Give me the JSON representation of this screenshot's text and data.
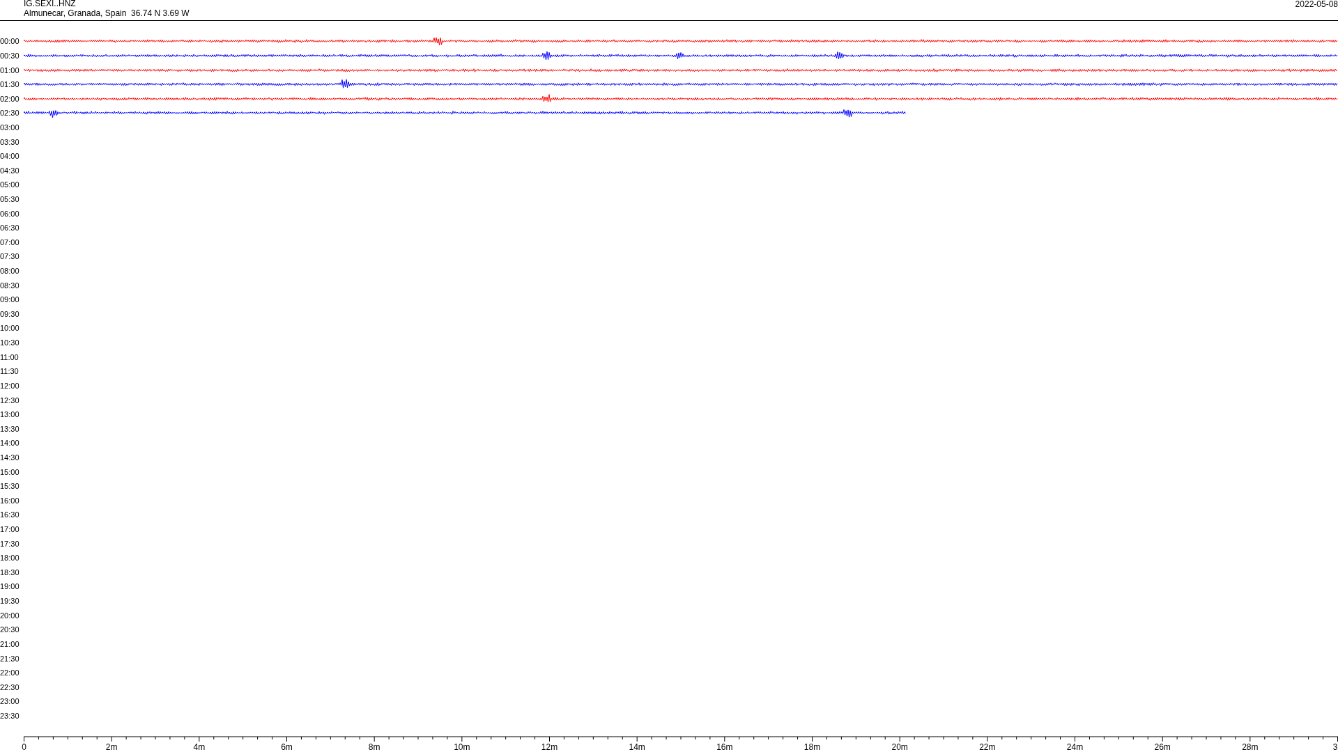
{
  "header": {
    "title": "IG.SEXI..HNZ",
    "location": "Almunecar, Granada, Spain  36.74 N 3.69 W",
    "date": "2022-05-08"
  },
  "rows": [
    {
      "label": "00:00",
      "trace": {
        "color": "#ff0000",
        "level": 1
      }
    },
    {
      "label": "00:30",
      "trace": {
        "color": "#0000ff",
        "level": 1
      }
    },
    {
      "label": "01:00",
      "trace": {
        "color": "#ff0000",
        "level": 1
      }
    },
    {
      "label": "01:30",
      "trace": {
        "color": "#0000ff",
        "level": 1
      }
    },
    {
      "label": "02:00",
      "trace": {
        "color": "#ff0000",
        "level": 1
      }
    },
    {
      "label": "02:30",
      "trace": {
        "color": "#0000ff",
        "level": 0.671
      }
    },
    {
      "label": "03:00"
    },
    {
      "label": "03:30"
    },
    {
      "label": "04:00"
    },
    {
      "label": "04:30"
    },
    {
      "label": "05:00"
    },
    {
      "label": "05:30"
    },
    {
      "label": "06:00"
    },
    {
      "label": "06:30"
    },
    {
      "label": "07:00"
    },
    {
      "label": "07:30"
    },
    {
      "label": "08:00"
    },
    {
      "label": "08:30"
    },
    {
      "label": "09:00"
    },
    {
      "label": "09:30"
    },
    {
      "label": "10:00"
    },
    {
      "label": "10:30"
    },
    {
      "label": "11:00"
    },
    {
      "label": "11:30"
    },
    {
      "label": "12:00"
    },
    {
      "label": "12:30"
    },
    {
      "label": "13:00"
    },
    {
      "label": "13:30"
    },
    {
      "label": "14:00"
    },
    {
      "label": "14:30"
    },
    {
      "label": "15:00"
    },
    {
      "label": "15:30"
    },
    {
      "label": "16:00"
    },
    {
      "label": "16:30"
    },
    {
      "label": "17:00"
    },
    {
      "label": "17:30"
    },
    {
      "label": "18:00"
    },
    {
      "label": "18:30"
    },
    {
      "label": "19:00"
    },
    {
      "label": "19:30"
    },
    {
      "label": "20:00"
    },
    {
      "label": "20:30"
    },
    {
      "label": "21:00"
    },
    {
      "label": "21:30"
    },
    {
      "label": "22:00"
    },
    {
      "label": "22:30"
    },
    {
      "label": "23:00"
    },
    {
      "label": "23:30"
    }
  ],
  "x_axis": {
    "ticks": [
      "0",
      "2m",
      "4m",
      "6m",
      "8m",
      "10m",
      "12m",
      "14m",
      "16m",
      "18m",
      "20m",
      "22m",
      "24m",
      "26m",
      "28m",
      "3"
    ]
  }
}
